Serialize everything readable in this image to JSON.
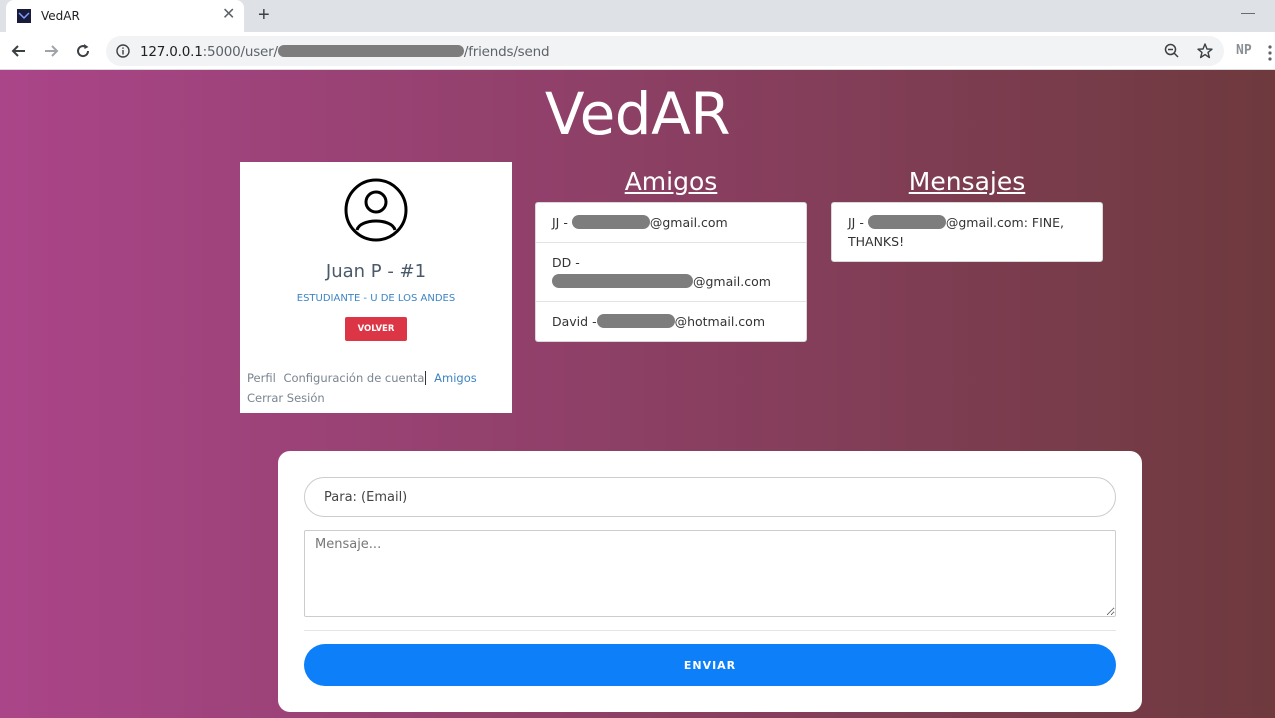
{
  "browser": {
    "tab_title": "VedAR",
    "url_prefix": "127.0.0.1",
    "url_port_path": ":5000/user/",
    "url_suffix": "/friends/send",
    "extension_label": "NP"
  },
  "page": {
    "brand": "VedAR",
    "profile": {
      "name": "Juan P - #1",
      "subtitle": "ESTUDIANTE - U DE LOS ANDES",
      "back_label": "VOLVER",
      "links": {
        "perfil": "Perfil",
        "config": "Configuración de cuenta",
        "amigos": "Amigos",
        "logout": "Cerrar Sesión"
      }
    },
    "friends": {
      "title": "Amigos",
      "items": [
        {
          "prefix": "JJ -",
          "suffix": "@gmail.com"
        },
        {
          "prefix": "DD -",
          "suffix": "@gmail.com"
        },
        {
          "prefix": "David -",
          "suffix": "@hotmail.com"
        }
      ]
    },
    "messages": {
      "title": "Mensajes",
      "items": [
        {
          "prefix": "JJ -",
          "suffix": "@gmail.com: FINE, THANKS!"
        }
      ]
    },
    "form": {
      "to_placeholder": "Para: (Email)",
      "message_placeholder": "Mensaje...",
      "send_label": "ENVIAR"
    }
  }
}
